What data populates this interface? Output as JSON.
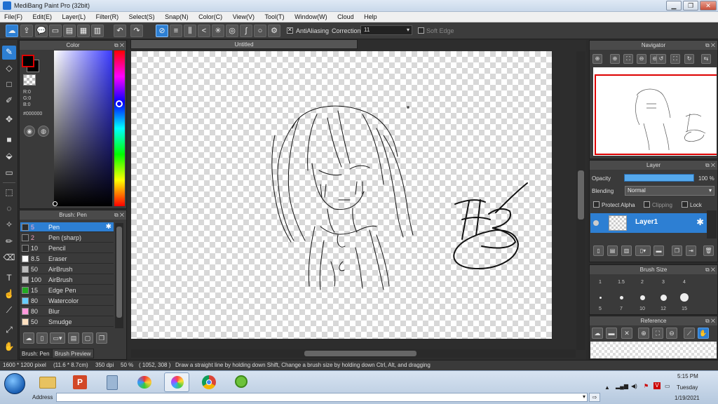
{
  "window": {
    "title": "MediBang Paint Pro (32bit)",
    "min": "▁",
    "max": "❐",
    "close": "✕"
  },
  "menu": [
    "File(F)",
    "Edit(E)",
    "Layer(L)",
    "Filter(R)",
    "Select(S)",
    "Snap(N)",
    "Color(C)",
    "View(V)",
    "Tool(T)",
    "Window(W)",
    "Cloud",
    "Help"
  ],
  "toolbar": {
    "antialiasing_label": "AntiAliasing",
    "correction_label": "Correction",
    "correction_value": "11",
    "soft_edge_label": "Soft Edge"
  },
  "color_panel": {
    "title": "Color",
    "r": "R:0",
    "g": "G:0",
    "b": "B:0",
    "hex": "#000000",
    "fg_color": "#000000",
    "hue_color": "#0000ff"
  },
  "brush_panel": {
    "title": "Brush: Pen",
    "items": [
      {
        "size": "5",
        "name": "Pen",
        "color": "#2d2d2d"
      },
      {
        "size": "2",
        "name": "Pen (sharp)",
        "color": "#2d2d2d"
      },
      {
        "size": "10",
        "name": "Pencil",
        "color": "#2d2d2d"
      },
      {
        "size": "8.5",
        "name": "Eraser",
        "color": "#ffffff"
      },
      {
        "size": "50",
        "name": "AirBrush",
        "color": "#bdbdbd"
      },
      {
        "size": "100",
        "name": "AirBrush",
        "color": "#bdbdbd"
      },
      {
        "size": "15",
        "name": "Edge Pen",
        "color": "#22aa22"
      },
      {
        "size": "80",
        "name": "Watercolor",
        "color": "#66ccff"
      },
      {
        "size": "80",
        "name": "Blur",
        "color": "#ff99dd"
      },
      {
        "size": "50",
        "name": "Smudge",
        "color": "#ffe0c0"
      }
    ],
    "tabs": [
      "Brush: Pen",
      "Brush Preview"
    ]
  },
  "document": {
    "tab_title": "Untitled"
  },
  "navigator": {
    "title": "Navigator"
  },
  "layer_panel": {
    "title": "Layer",
    "opacity_label": "Opacity",
    "opacity_value": "100 %",
    "opacity_fraction": 1.0,
    "blending_label": "Blending",
    "blending_value": "Normal",
    "protect_alpha": "Protect Alpha",
    "clipping": "Clipping",
    "lock": "Lock",
    "layer_name": "Layer1"
  },
  "brush_size_panel": {
    "title": "Brush Size",
    "row1": [
      "1",
      "1.5",
      "2",
      "3",
      "4"
    ],
    "row2": [
      "5",
      "7",
      "10",
      "12",
      "15"
    ]
  },
  "reference_panel": {
    "title": "Reference"
  },
  "status": {
    "size": "1600 * 1200 pixel",
    "physical": "(11.6 * 8.7cm)",
    "dpi": "350 dpi",
    "zoom": "50 %",
    "coords": "( 1052, 308 )",
    "hint": "Draw a straight line by holding down Shift, Change a brush size by holding down Ctrl, Alt, and dragging"
  },
  "taskbar": {
    "time": "5:15 PM",
    "day": "Tuesday",
    "date": "1/19/2021",
    "address_label": "Address"
  }
}
